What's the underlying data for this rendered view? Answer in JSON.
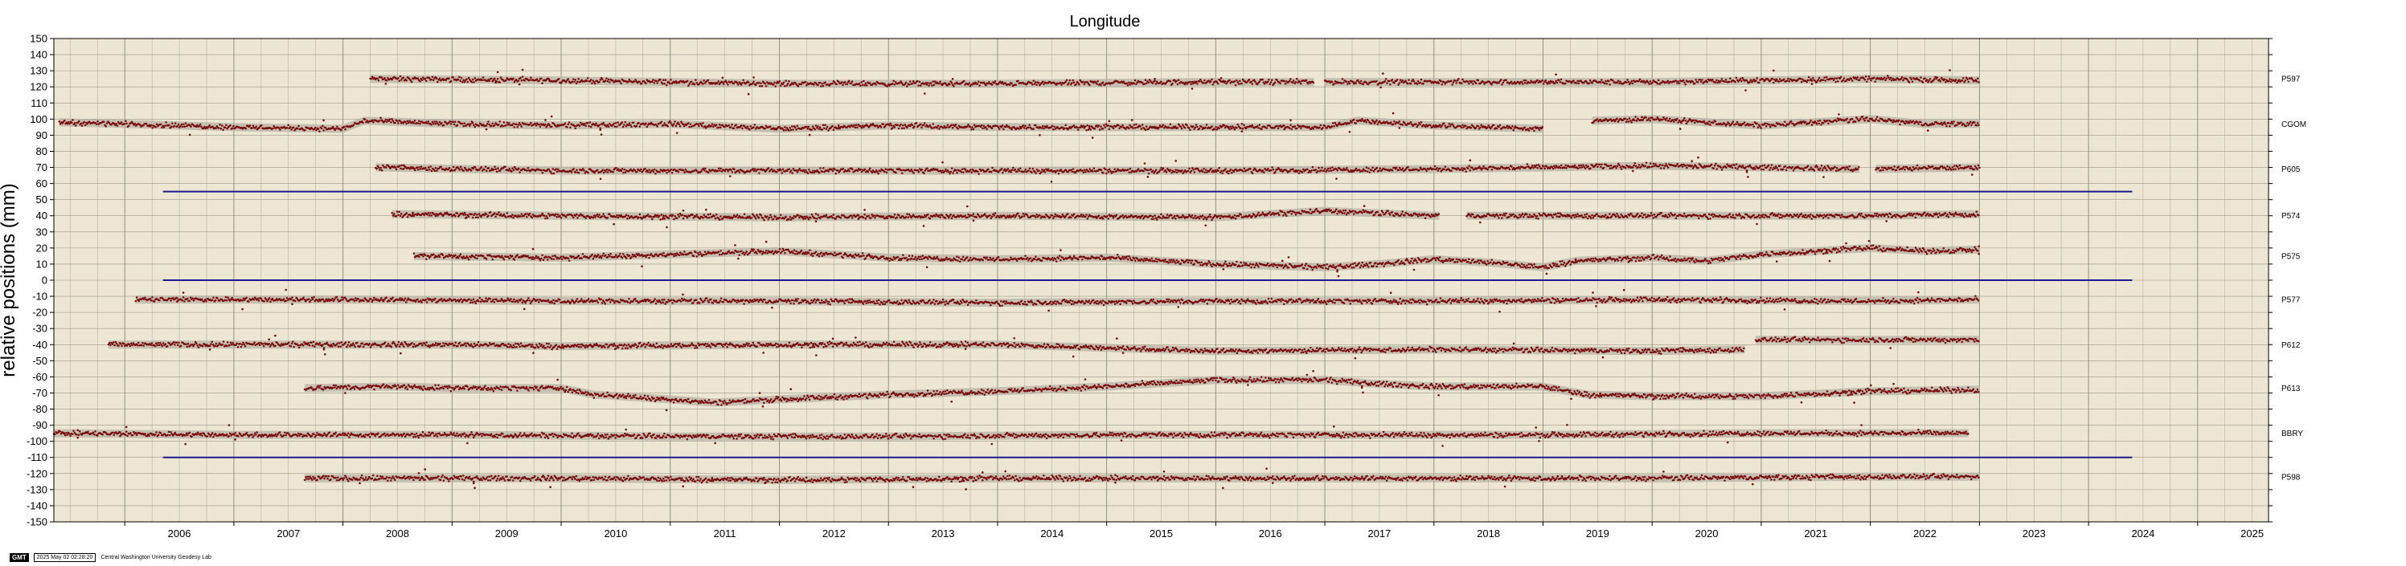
{
  "chart_data": {
    "type": "scatter",
    "title": "Longitude",
    "ylabel": "relative positions (mm)",
    "xlabel": "",
    "xlim": [
      2005.35,
      2025.65
    ],
    "ylim": [
      -150,
      150
    ],
    "x_ticks": [
      "2006",
      "2007",
      "2008",
      "2009",
      "2010",
      "2011",
      "2012",
      "2013",
      "2014",
      "2015",
      "2016",
      "2017",
      "2018",
      "2019",
      "2020",
      "2021",
      "2022",
      "2023",
      "2024",
      "2025"
    ],
    "y_ticks": [
      "150",
      "140",
      "130",
      "120",
      "110",
      "100",
      "90",
      "80",
      "70",
      "60",
      "50",
      "40",
      "30",
      "20",
      "10",
      "0",
      "-10",
      "-20",
      "-30",
      "-40",
      "-50",
      "-60",
      "-70",
      "-80",
      "-90",
      "-100",
      "-110",
      "-120",
      "-130",
      "-140",
      "-150"
    ],
    "grid": true,
    "background_color": "#ece6d2",
    "point_color": "#7a0a0a",
    "error_band_color": "#b7b2a6",
    "reference_line_color": "#1a1a8c",
    "reference_lines": [
      {
        "y": 55,
        "x_start": 2006.35,
        "x_end": 2024.4
      },
      {
        "y": 0,
        "x_start": 2006.35,
        "x_end": 2024.4
      },
      {
        "y": -110,
        "x_start": 2006.35,
        "x_end": 2024.4
      }
    ],
    "series": [
      {
        "name": "P597",
        "offset": 125,
        "segments": [
          [
            2008.25,
            2016.9
          ],
          [
            2017.0,
            2023.0
          ]
        ],
        "trend": [
          [
            2008.25,
            125
          ],
          [
            2010,
            124
          ],
          [
            2012,
            122
          ],
          [
            2014,
            122
          ],
          [
            2016,
            123
          ],
          [
            2018,
            123
          ],
          [
            2020,
            123
          ],
          [
            2022,
            125
          ],
          [
            2023,
            124
          ]
        ]
      },
      {
        "name": "CGOM",
        "offset": 97,
        "segments": [
          [
            2005.4,
            2019.0
          ],
          [
            2019.45,
            2023.0
          ]
        ],
        "trend": [
          [
            2005.4,
            98
          ],
          [
            2006,
            97
          ],
          [
            2007,
            95
          ],
          [
            2008,
            94
          ],
          [
            2008.2,
            99
          ],
          [
            2009,
            97
          ],
          [
            2010,
            96
          ],
          [
            2011,
            97
          ],
          [
            2012,
            94
          ],
          [
            2013,
            96
          ],
          [
            2014,
            95
          ],
          [
            2015,
            95
          ],
          [
            2016,
            95
          ],
          [
            2017,
            95
          ],
          [
            2017.3,
            99
          ],
          [
            2018,
            96
          ],
          [
            2019,
            94
          ],
          [
            2019.45,
            99
          ],
          [
            2020,
            100
          ],
          [
            2021,
            96
          ],
          [
            2022,
            100
          ],
          [
            2022.5,
            97
          ],
          [
            2023,
            97
          ]
        ]
      },
      {
        "name": "P605",
        "offset": 69,
        "segments": [
          [
            2008.3,
            2021.9
          ],
          [
            2022.05,
            2023.0
          ]
        ],
        "trend": [
          [
            2008.3,
            70
          ],
          [
            2010,
            68
          ],
          [
            2012,
            68
          ],
          [
            2014,
            68
          ],
          [
            2016,
            68
          ],
          [
            2018,
            69
          ],
          [
            2020,
            71
          ],
          [
            2021,
            70
          ],
          [
            2022,
            69
          ],
          [
            2023,
            70
          ]
        ]
      },
      {
        "name": "P574",
        "offset": 40,
        "segments": [
          [
            2008.45,
            2018.05
          ],
          [
            2018.3,
            2023.0
          ]
        ],
        "trend": [
          [
            2008.45,
            41
          ],
          [
            2010,
            40
          ],
          [
            2012,
            39
          ],
          [
            2014,
            40
          ],
          [
            2016,
            39
          ],
          [
            2017,
            43
          ],
          [
            2018,
            40
          ],
          [
            2018.3,
            40
          ],
          [
            2020,
            40
          ],
          [
            2022,
            40
          ],
          [
            2023,
            41
          ]
        ]
      },
      {
        "name": "P575",
        "offset": 15,
        "segments": [
          [
            2008.65,
            2023.0
          ]
        ],
        "trend": [
          [
            2008.65,
            15
          ],
          [
            2010,
            14
          ],
          [
            2011,
            16
          ],
          [
            2012,
            18
          ],
          [
            2013,
            14
          ],
          [
            2014,
            13
          ],
          [
            2015,
            14
          ],
          [
            2016,
            10
          ],
          [
            2017,
            8
          ],
          [
            2017.5,
            10
          ],
          [
            2018,
            13
          ],
          [
            2018.5,
            11
          ],
          [
            2019,
            8
          ],
          [
            2019.3,
            12
          ],
          [
            2020,
            14
          ],
          [
            2020.5,
            12
          ],
          [
            2021,
            16
          ],
          [
            2022,
            20
          ],
          [
            2022.5,
            18
          ],
          [
            2023,
            19
          ]
        ]
      },
      {
        "name": "P577",
        "offset": -12,
        "segments": [
          [
            2006.1,
            2023.0
          ]
        ],
        "trend": [
          [
            2006.1,
            -12
          ],
          [
            2008,
            -12
          ],
          [
            2010,
            -13
          ],
          [
            2012,
            -13
          ],
          [
            2014,
            -14
          ],
          [
            2016,
            -13
          ],
          [
            2018,
            -13
          ],
          [
            2020,
            -12
          ],
          [
            2022,
            -13
          ],
          [
            2023,
            -12
          ]
        ]
      },
      {
        "name": "P612",
        "offset": -40,
        "segments": [
          [
            2005.85,
            2020.85
          ],
          [
            2020.95,
            2023.0
          ]
        ],
        "trend": [
          [
            2005.85,
            -40
          ],
          [
            2007,
            -40
          ],
          [
            2009,
            -40
          ],
          [
            2010,
            -41
          ],
          [
            2012,
            -40
          ],
          [
            2014,
            -40
          ],
          [
            2015,
            -42
          ],
          [
            2016,
            -44
          ],
          [
            2018,
            -43
          ],
          [
            2020,
            -44
          ],
          [
            2020.85,
            -43
          ],
          [
            2020.95,
            -37
          ],
          [
            2022,
            -37
          ],
          [
            2023,
            -37
          ]
        ]
      },
      {
        "name": "P613",
        "offset": -67,
        "segments": [
          [
            2007.65,
            2023.0
          ]
        ],
        "trend": [
          [
            2007.65,
            -67
          ],
          [
            2008.5,
            -66
          ],
          [
            2009,
            -67
          ],
          [
            2010,
            -67
          ],
          [
            2010.3,
            -71
          ],
          [
            2011,
            -74
          ],
          [
            2011.4,
            -76
          ],
          [
            2012,
            -74
          ],
          [
            2013,
            -71
          ],
          [
            2014,
            -69
          ],
          [
            2015,
            -66
          ],
          [
            2016,
            -62
          ],
          [
            2017,
            -62
          ],
          [
            2017.4,
            -64
          ],
          [
            2018,
            -66
          ],
          [
            2019,
            -66
          ],
          [
            2019.4,
            -71
          ],
          [
            2020,
            -72
          ],
          [
            2021,
            -72
          ],
          [
            2022,
            -69
          ],
          [
            2023,
            -68
          ]
        ]
      },
      {
        "name": "BBRY",
        "offset": -95,
        "segments": [
          [
            2005.35,
            2022.9
          ]
        ],
        "trend": [
          [
            2005.35,
            -95
          ],
          [
            2007,
            -96
          ],
          [
            2009,
            -96
          ],
          [
            2011,
            -97
          ],
          [
            2013,
            -97
          ],
          [
            2015,
            -96
          ],
          [
            2017,
            -96
          ],
          [
            2019,
            -96
          ],
          [
            2021,
            -95
          ],
          [
            2022.9,
            -95
          ]
        ]
      },
      {
        "name": "P598",
        "offset": -122,
        "segments": [
          [
            2007.65,
            2023.0
          ]
        ],
        "trend": [
          [
            2007.65,
            -123
          ],
          [
            2010,
            -123
          ],
          [
            2012,
            -124
          ],
          [
            2014,
            -123
          ],
          [
            2016,
            -123
          ],
          [
            2018,
            -123
          ],
          [
            2020,
            -123
          ],
          [
            2022,
            -122
          ],
          [
            2023,
            -122
          ]
        ]
      }
    ]
  },
  "footer": {
    "logo": "GMT",
    "date": "2025 May 02 02:28:20",
    "credit": "Central Washington University Geodesy Lab"
  }
}
